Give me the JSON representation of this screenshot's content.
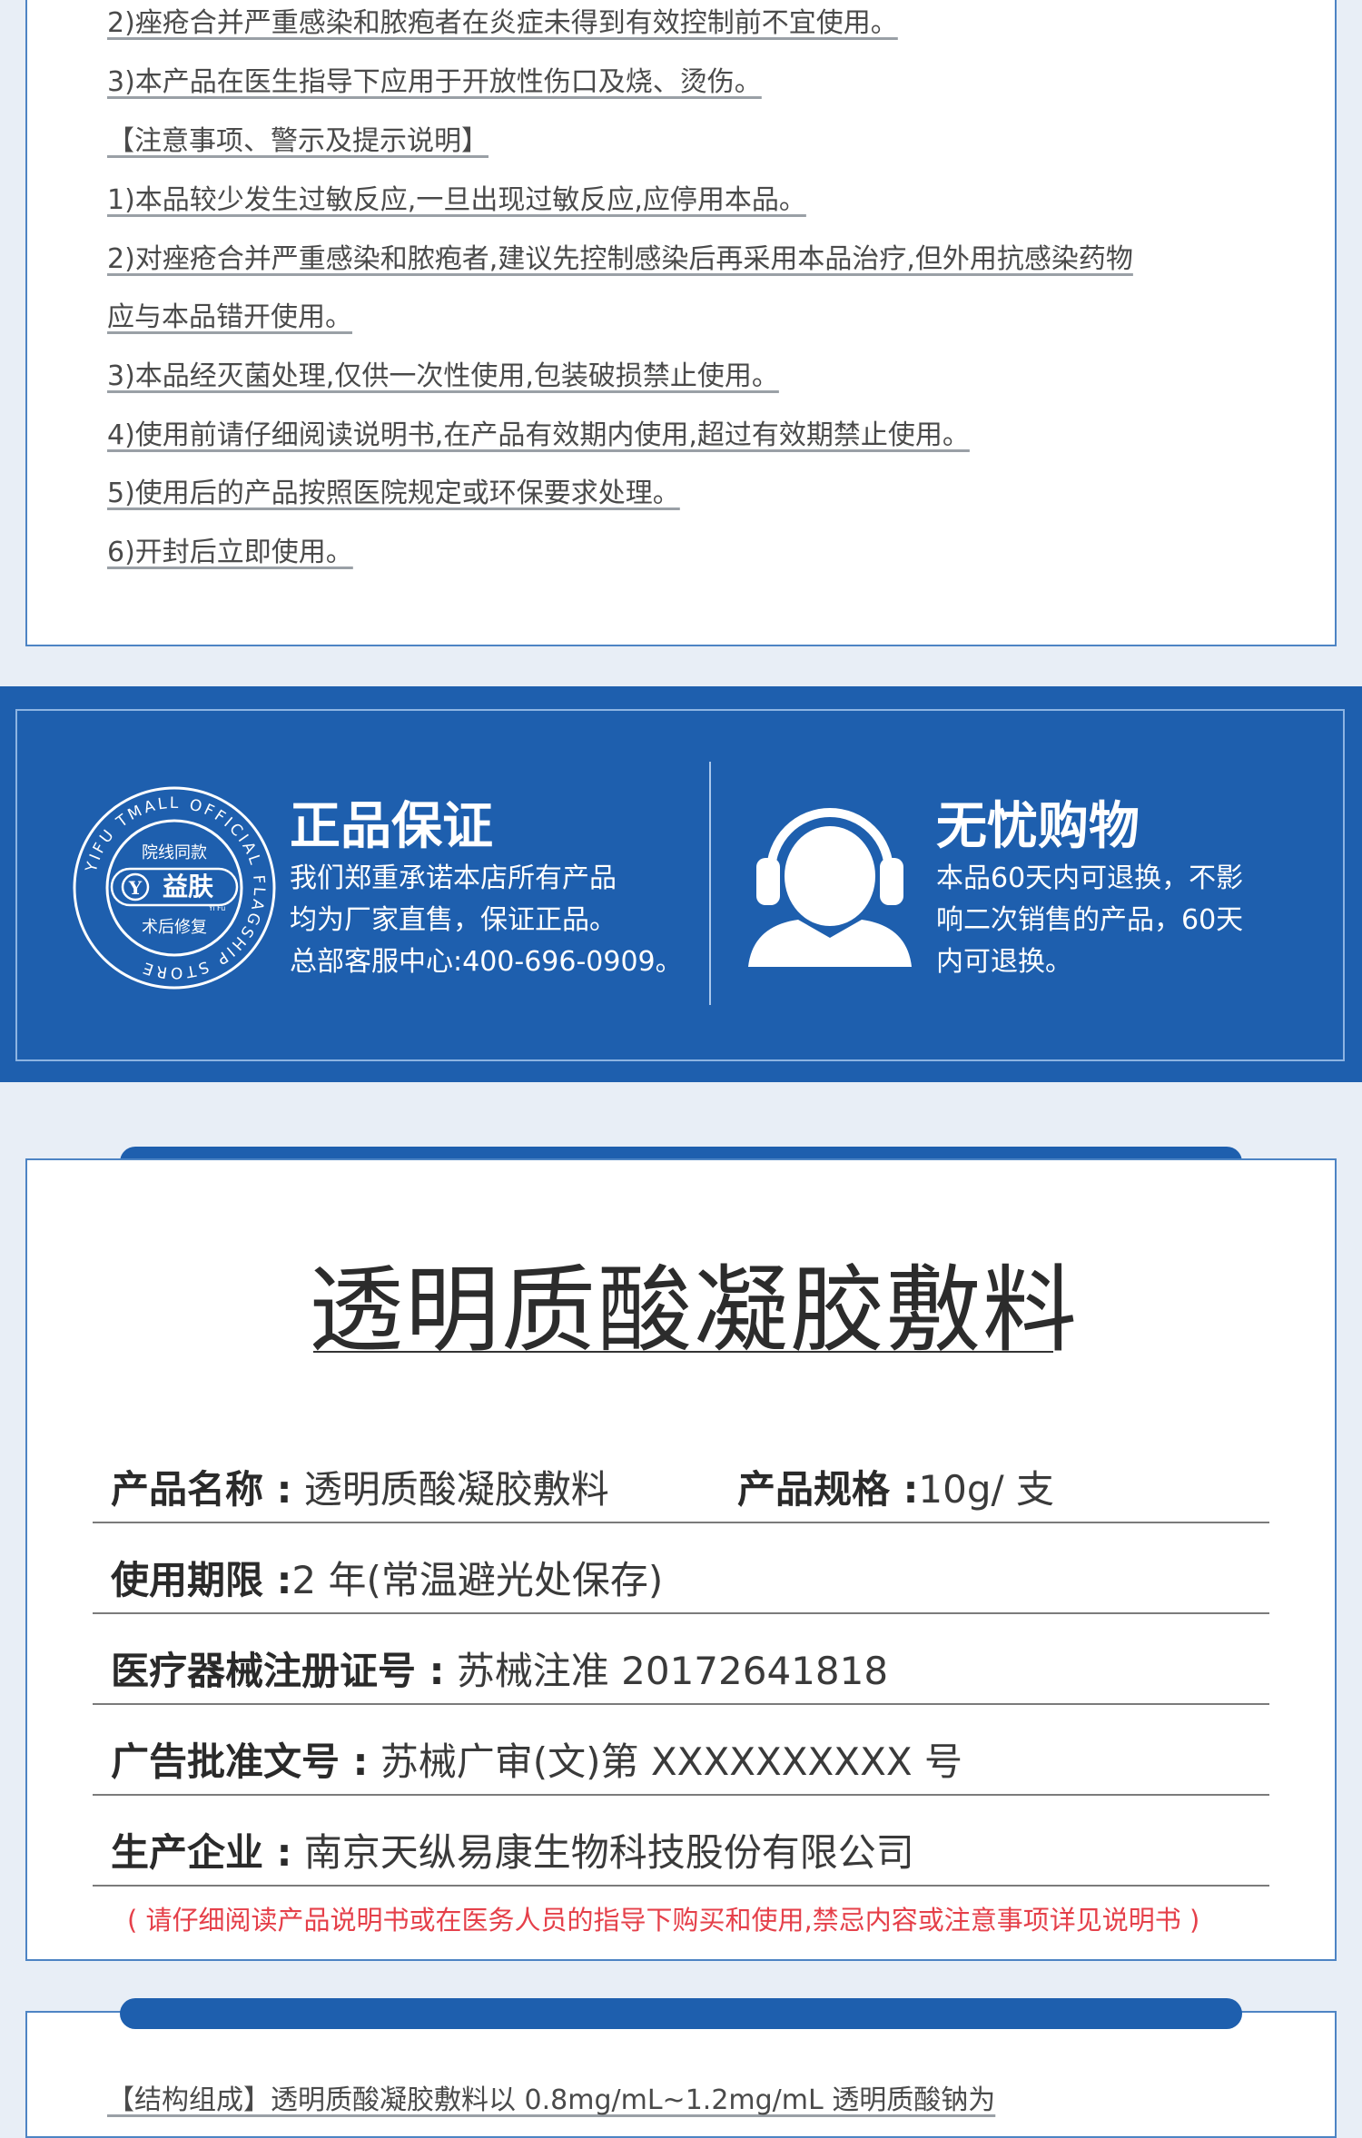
{
  "instructions": {
    "lines": [
      "2)痤疮合并严重感染和脓疱者在炎症未得到有效控制前不宜使用。",
      "3)本产品在医生指导下应用于开放性伤口及烧、烫伤。",
      "【注意事项、警示及提示说明】",
      "1)本品较少发生过敏反应,一旦出现过敏反应,应停用本品。",
      "2)对痤疮合并严重感染和脓疱者,建议先控制感染后再采用本品治疗,但外用抗感染药物",
      "应与本品错开使用。",
      "3)本品经灭菌处理,仅供一次性使用,包装破损禁止使用。",
      "4)使用前请仔细阅读说明书,在产品有效期内使用,超过有效期禁止使用。",
      "5)使用后的产品按照医院规定或环保要求处理。",
      "6)开封后立即使用。"
    ]
  },
  "guarantee": {
    "badge": {
      "ring_text": "YIFU TMALL OFFICIAL FLAGSHIP STORE",
      "top_text": "院线同款",
      "brand": "益肤",
      "brand_small": "Yi Fu",
      "bottom_text": "术后修复"
    },
    "left": {
      "title": "正品保证",
      "lines": [
        "我们郑重承诺本店所有产品",
        "均为厂家直售，保证正品。",
        "总部客服中心:400-696-0909。"
      ]
    },
    "right": {
      "title": "无忧购物",
      "lines": [
        "本品60天内可退换，不影",
        "响二次销售的产品，60天",
        "内可退换。"
      ]
    }
  },
  "product": {
    "title": "透明质酸凝胶敷料",
    "specs": [
      {
        "label": "产品名称 :",
        "value": " 透明质酸凝胶敷料",
        "label2": "产品规格 :",
        "value2": "10g/ 支"
      },
      {
        "label": "使用期限 :",
        "value": "2 年(常温避光处保存)"
      },
      {
        "label": "医疗器械注册证号 :",
        "value": " 苏械注准 20172641818"
      },
      {
        "label": "广告批准文号 :",
        "value": " 苏械广审(文)第 XXXXXXXXXX 号"
      },
      {
        "label": "生产企业 :",
        "value": " 南京天纵易康生物科技股份有限公司"
      }
    ],
    "notice": "( 请仔细阅读产品说明书或在医务人员的指导下购买和使用,禁忌内容或注意事项详见说明书 )"
  },
  "structure": {
    "text": "【结构组成】透明质酸凝胶敷料以 0.8mg/mL~1.2mg/mL 透明质酸钠为"
  },
  "colors": {
    "brand_blue": "#1e5fae",
    "notice_red": "#e5404a"
  },
  "icons": {
    "badge": "flagship-seal-icon",
    "service": "headset-agent-icon"
  }
}
